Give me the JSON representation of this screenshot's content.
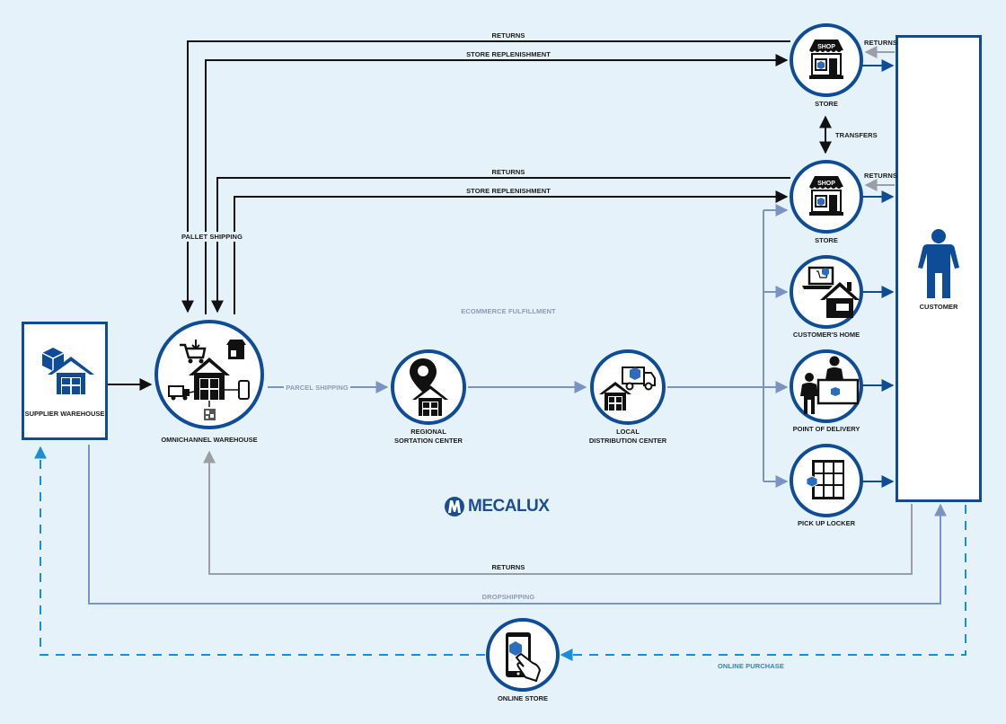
{
  "diagram": {
    "brand": "MECALUX",
    "colors": {
      "background": "#e6f2fa",
      "node_border": "#0f4c97",
      "black_flow": "#111111",
      "ecommerce_flow": "#7b92c4",
      "returns_flow": "#9a9ea6",
      "online_flow": "#1a8fd6",
      "customer_icon": "#0f4c97"
    },
    "nodes": {
      "supplier_warehouse": {
        "label": "SUPPLIER WAREHOUSE",
        "icon": "warehouse-with-box-icon"
      },
      "omnichannel_warehouse": {
        "label": "OMNICHANNEL WAREHOUSE",
        "icon": "omnichannel-warehouse-icon"
      },
      "regional_sortation": {
        "label_line1": "REGIONAL",
        "label_line2": "SORTATION CENTER",
        "icon": "location-pin-warehouse-icon"
      },
      "local_distribution": {
        "label_line1": "LOCAL",
        "label_line2": "DISTRIBUTION CENTER",
        "icon": "warehouse-truck-icon"
      },
      "store_1": {
        "label": "STORE",
        "icon": "shop-icon",
        "sign": "SHOP"
      },
      "store_2": {
        "label": "STORE",
        "icon": "shop-icon",
        "sign": "SHOP"
      },
      "customers_home": {
        "label": "CUSTOMER'S HOME",
        "icon": "laptop-house-icon"
      },
      "point_of_delivery": {
        "label": "POINT OF DELIVERY",
        "icon": "people-counter-icon"
      },
      "pickup_locker": {
        "label": "PICK UP LOCKER",
        "icon": "locker-icon"
      },
      "customer": {
        "label": "CUSTOMER",
        "icon": "person-icon"
      },
      "online_store": {
        "label": "ONLINE STORE",
        "icon": "smartphone-tap-icon"
      }
    },
    "flows": {
      "returns_top": "RETURNS",
      "store_replenishment_top": "STORE REPLENISHMENT",
      "returns_mid": "RETURNS",
      "store_replenishment_mid": "STORE REPLENISHMENT",
      "pallet_shipping": "PALLET SHIPPING",
      "transfers": "TRANSFERS",
      "store1_returns": "RETURNS",
      "store2_returns": "RETURNS",
      "ecommerce_fulfillment": "ECOMMERCE FULFILLMENT",
      "parcel_shipping": "PARCEL SHIPPING",
      "returns_bottom": "RETURNS",
      "dropshipping": "DROPSHIPPING",
      "online_purchase": "ONLINE PURCHASE"
    }
  }
}
